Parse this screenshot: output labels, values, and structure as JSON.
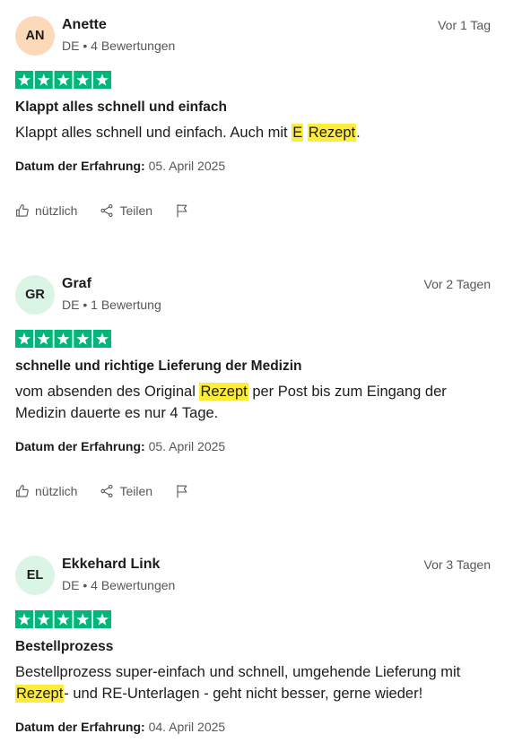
{
  "colors": {
    "background": "#ffffff",
    "text": "#1c1c1c",
    "muted": "#575757",
    "star_green": "#00b67a",
    "highlight": "#fdec3a"
  },
  "labels": {
    "meta_separator": "•",
    "date_of_experience": "Datum der Erfahrung:",
    "helpful": "nützlich",
    "share": "Teilen"
  },
  "icons": {
    "helpful": "thumbs-up-icon",
    "share": "share-icon",
    "report": "flag-icon",
    "rating": "star-icon"
  },
  "reviews": [
    {
      "initials": "AN",
      "avatar_color": "#fcd9b8",
      "name": "Anette",
      "country": "DE",
      "review_count": "4 Bewertungen",
      "age": "Vor 1 Tag",
      "rating": 5,
      "title": "Klappt alles schnell und einfach",
      "body": [
        {
          "text": "Klappt alles schnell und einfach. Auch mit ",
          "highlight": false
        },
        {
          "text": "E",
          "highlight": true
        },
        {
          "text": " ",
          "highlight": false
        },
        {
          "text": "Rezept",
          "highlight": true
        },
        {
          "text": ".",
          "highlight": false
        }
      ],
      "date_of_experience": "05. April 2025"
    },
    {
      "initials": "GR",
      "avatar_color": "#daf5e6",
      "name": "Graf",
      "country": "DE",
      "review_count": "1 Bewertung",
      "age": "Vor 2 Tagen",
      "rating": 5,
      "title": "schnelle und richtige Lieferung der Medizin",
      "body": [
        {
          "text": "vom absenden des Original ",
          "highlight": false
        },
        {
          "text": "Rezept",
          "highlight": true
        },
        {
          "text": " per Post bis zum Eingang der Medizin dauerte es nur 4 Tage.",
          "highlight": false
        }
      ],
      "date_of_experience": "05. April 2025"
    },
    {
      "initials": "EL",
      "avatar_color": "#daf5e6",
      "name": "Ekkehard Link",
      "country": "DE",
      "review_count": "4 Bewertungen",
      "age": "Vor 3 Tagen",
      "rating": 5,
      "title": "Bestellprozess",
      "body": [
        {
          "text": "Bestellprozess super-einfach und schnell, umgehende Lieferung mit ",
          "highlight": false
        },
        {
          "text": "Rezept",
          "highlight": true
        },
        {
          "text": "- und RE-Unterlagen - geht nicht besser, gerne wieder!",
          "highlight": false
        }
      ],
      "date_of_experience": "04. April 2025"
    }
  ]
}
